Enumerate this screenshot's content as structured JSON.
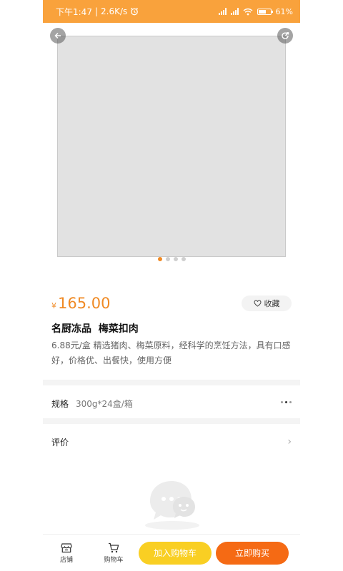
{
  "status_bar": {
    "time": "下午1:47",
    "network_speed": "2.6K/s",
    "network_type": "HD",
    "battery": "61"
  },
  "hero": {
    "back_icon": "arrow-left-icon",
    "share_icon": "share-icon",
    "slide_count": 4,
    "active_slide": 1
  },
  "product": {
    "currency": "¥",
    "price": "165.00",
    "favorite_label": "收藏",
    "title": "名厨冻品  梅菜扣肉",
    "description": "6.88元/盒  精选猪肉、梅菜原料，经科学的烹饪方法，具有口感好，价格优、出餐快，使用方便"
  },
  "spec": {
    "label": "规格",
    "value": "300g*24盒/箱"
  },
  "review": {
    "label": "评价"
  },
  "bottom_bar": {
    "store_label": "店铺",
    "cart_label": "购物车",
    "add_to_cart_label": "加入购物车",
    "buy_now_label": "立即购买"
  },
  "colors": {
    "accent": "#f08a24",
    "status_bar": "#f9a23c",
    "add_to_cart": "#f9cf23",
    "buy_now": "#f56a14"
  }
}
